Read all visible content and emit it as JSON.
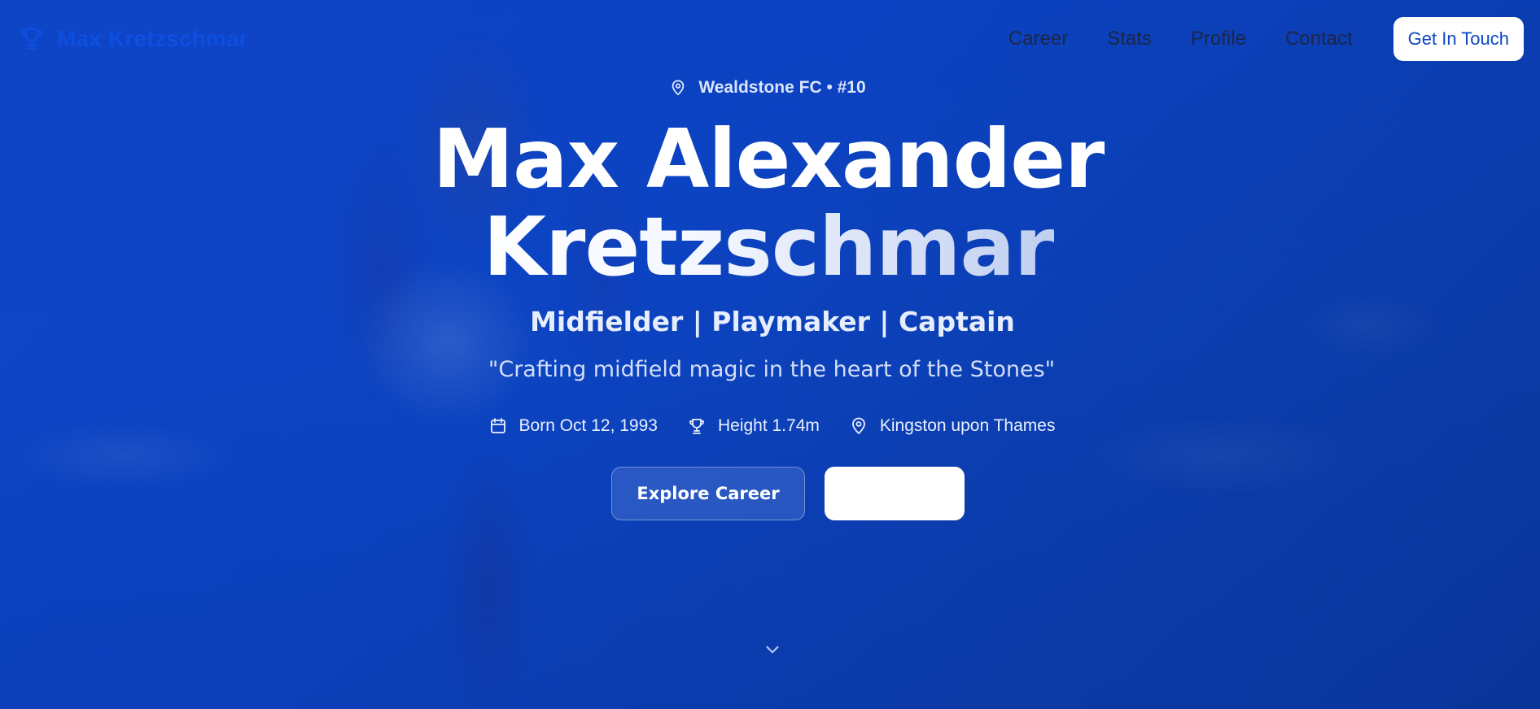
{
  "nav": {
    "brand_icon": "trophy-icon",
    "brand_name": "Max Kretzschmar",
    "links": [
      {
        "label": "Career"
      },
      {
        "label": "Stats"
      },
      {
        "label": "Profile"
      },
      {
        "label": "Contact"
      }
    ],
    "cta_label": "Get In Touch"
  },
  "hero": {
    "club_icon": "map-pin-icon",
    "club_line": "Wealdstone FC • #10",
    "title_line1": "Max Alexander",
    "title_line2": "Kretzschmar",
    "roles": "Midfielder | Playmaker | Captain",
    "quote": "\"Crafting midfield magic in the heart of the Stones\"",
    "facts": [
      {
        "icon": "calendar-icon",
        "text": "Born Oct 12, 1993"
      },
      {
        "icon": "trophy-icon",
        "text": "Height 1.74m"
      },
      {
        "icon": "map-pin-icon",
        "text": "Kingston upon Thames"
      }
    ],
    "primary_button": "Explore Career",
    "secondary_button": "",
    "scroll_icon": "chevron-down-icon"
  },
  "colors": {
    "background": "#0c44c2",
    "brand_text": "#0d4fe0",
    "nav_text": "#1c2745",
    "cta_text": "#0f45c4"
  }
}
